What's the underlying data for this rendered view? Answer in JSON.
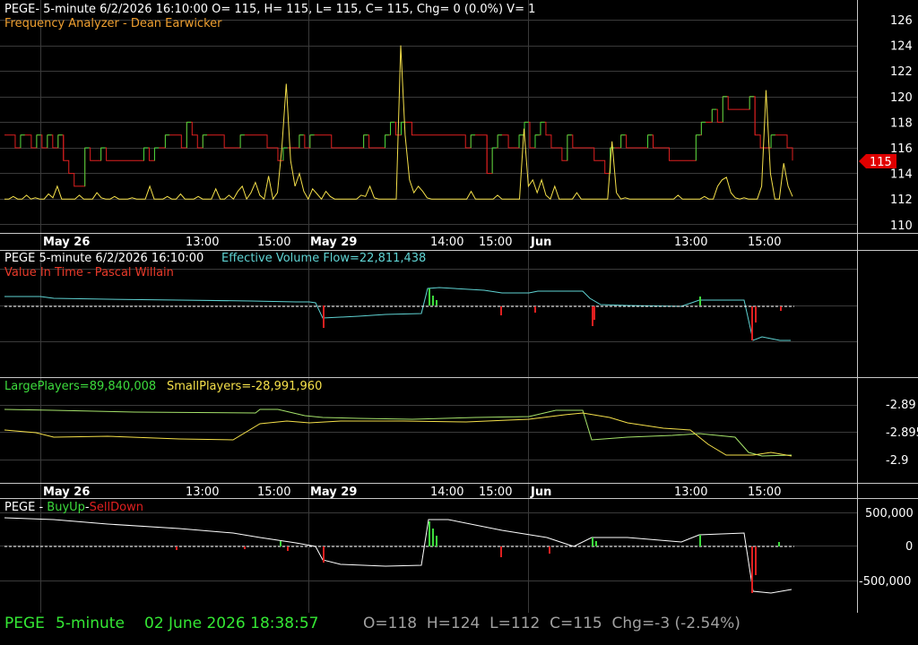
{
  "colors": {
    "background": "#000000",
    "grid": "#3a3a3a",
    "white": "#ffffff",
    "green": "#3ddc3d",
    "bright_green": "#34e834",
    "red": "#e02020",
    "yellow": "#f5e04a",
    "orange_title": "#f0a030",
    "cyan": "#5fd3d3",
    "light_green_line": "#a6e36b",
    "price_tag": "#e00000",
    "gray_text": "#a0a0a0"
  },
  "panel1": {
    "header": "PEGE- 5-minute 6/2/2026 16:10:00 O= 115, H= 115, L= 115, C= 115, Chg= 0 (0.0%) V= 1",
    "indicator": "Frequency Analyzer - Dean Earwicker",
    "price_tag": "115"
  },
  "time_axis": {
    "labels": [
      "May 26",
      "13:00",
      "15:00",
      "May 29",
      "14:00",
      "15:00",
      "Jun",
      "13:00",
      "15:00"
    ],
    "bold": [
      true,
      false,
      false,
      true,
      false,
      false,
      true,
      false,
      false
    ]
  },
  "panel2": {
    "symbol": "PEGE 5-minute  6/2/2026 16:10:00",
    "flow_label": "Effective Volume Flow=22,811,438",
    "indicator": "Value In Time - Pascal Willain"
  },
  "panel3": {
    "large_label": "LargePlayers=89,840,008",
    "small_label": "SmallPlayers=-28,991,960"
  },
  "panel4": {
    "prefix": "PEGE - ",
    "buy": "BuyUp",
    "dash": "-",
    "sell": "SellDown"
  },
  "status_bar": {
    "symbol": "PEGE",
    "interval": "5-minute",
    "datetime": "02 June 2026 18:38:57",
    "ohlc": "O=118  H=124  L=112  C=115  Chg=-3 (-2.54%)"
  },
  "chart_data": [
    {
      "type": "line",
      "title": "Frequency Analyzer - Dean Earwicker",
      "y_ticks": [
        "126",
        "124",
        "122",
        "120",
        "118",
        "116",
        "114",
        "112",
        "110"
      ],
      "ylim": [
        110,
        126
      ],
      "x_ticks": [
        "May 26",
        "13:00",
        "15:00",
        "May 29",
        "14:00",
        "15:00",
        "Jun",
        "13:00",
        "15:00"
      ],
      "last_price": 115,
      "series": [
        {
          "kind": "price-steps",
          "color": "#e02020",
          "values": [
            117,
            117,
            116,
            117,
            117,
            116,
            117,
            116,
            117,
            116,
            117,
            115,
            114,
            113,
            113,
            116,
            115,
            115,
            116,
            115,
            115,
            115,
            115,
            115,
            115,
            115,
            116,
            115,
            116,
            116,
            117,
            117,
            117,
            116,
            118,
            117,
            116,
            117,
            117,
            117,
            117,
            116,
            116,
            116,
            117,
            117,
            117,
            117,
            117,
            116,
            116,
            115,
            116,
            116,
            116,
            117,
            116,
            117,
            117,
            117,
            117,
            116,
            116,
            116,
            116,
            116,
            116,
            117,
            116,
            116,
            116,
            117,
            118,
            117,
            118,
            118,
            117,
            117,
            117,
            117,
            117,
            117,
            117,
            117,
            117,
            117,
            116,
            117,
            117,
            117,
            114,
            116,
            117,
            117,
            116,
            116,
            117,
            118,
            116,
            117,
            118,
            117,
            116,
            116,
            115,
            117,
            116,
            116,
            116,
            116,
            115,
            115,
            114,
            116,
            116,
            117,
            116,
            116,
            116,
            116,
            117,
            116,
            116,
            116,
            115,
            115,
            115,
            115,
            115,
            117,
            118,
            118,
            119,
            118,
            120,
            119,
            119,
            119,
            119,
            120,
            117,
            116,
            116,
            117,
            117,
            117,
            116,
            115
          ]
        },
        {
          "kind": "frequency",
          "color": "#f5e04a",
          "values": [
            112,
            112,
            112.2,
            112,
            112,
            112.3,
            112,
            112.1,
            112,
            112,
            112.4,
            112.1,
            113,
            112,
            112,
            112,
            112,
            112.3,
            112,
            112,
            112,
            112.5,
            112.1,
            112,
            112,
            112.2,
            112,
            112,
            112,
            112.1,
            112,
            112,
            112,
            113,
            112,
            112,
            112,
            112.2,
            112,
            112,
            112.4,
            112,
            112,
            112,
            112.2,
            112,
            112,
            112,
            112.8,
            112,
            112,
            112.3,
            112,
            112.6,
            113,
            112,
            112.5,
            113.3,
            112.3,
            112,
            113.8,
            112,
            112.5,
            116,
            121,
            115,
            113,
            114,
            112.6,
            112,
            112.8,
            112.4,
            112,
            112.6,
            112.2,
            112,
            112,
            112,
            112,
            112,
            112,
            112.3,
            112.2,
            113,
            112.1,
            112,
            112,
            112,
            112,
            112,
            124,
            117,
            113.5,
            112.5,
            113,
            112.6,
            112.1,
            112,
            112,
            112,
            112,
            112,
            112,
            112,
            112,
            112,
            112.6,
            112,
            112,
            112,
            112,
            112,
            112.3,
            112,
            112,
            112,
            112,
            112,
            117.5,
            113,
            113.5,
            112.5,
            113.5,
            112.3,
            112,
            113,
            112,
            112,
            112,
            112,
            112.5,
            112,
            112,
            112,
            112,
            112,
            112,
            112,
            116.5,
            112.5,
            112,
            112.1,
            112,
            112,
            112,
            112,
            112,
            112,
            112,
            112,
            112,
            112,
            112,
            112.3,
            112,
            112,
            112,
            112,
            112,
            112.2,
            112,
            112,
            113,
            113.5,
            113.7,
            112.5,
            112.1,
            112,
            112.1,
            112,
            112,
            112,
            113,
            120.5,
            114,
            112,
            112,
            114.8,
            113,
            112.2
          ]
        },
        {
          "kind": "buy-marks",
          "color": "#3ddc3d"
        }
      ]
    },
    {
      "type": "line",
      "title": "Value In Time - Pascal Willain",
      "series": [
        {
          "name": "Effective Volume Flow",
          "color": "#5fd3d3",
          "last_value": 22811438
        }
      ]
    },
    {
      "type": "line",
      "series": [
        {
          "name": "LargePlayers",
          "color": "#a6e36b",
          "last_value": 89840008
        },
        {
          "name": "SmallPlayers",
          "color": "#f5e04a",
          "last_value": -28991960
        }
      ],
      "y_ticks": [
        "-2.89",
        "-2.895",
        "-2.9"
      ]
    },
    {
      "type": "bar",
      "title": "PEGE - BuyUp-SellDown",
      "series": [
        {
          "name": "BuyUp",
          "color": "#3ddc3d"
        },
        {
          "name": "SellDown",
          "color": "#e02020"
        }
      ],
      "y_ticks": [
        "500,000",
        "0",
        "-500,000"
      ],
      "ylim": [
        -650000,
        500000
      ]
    }
  ]
}
